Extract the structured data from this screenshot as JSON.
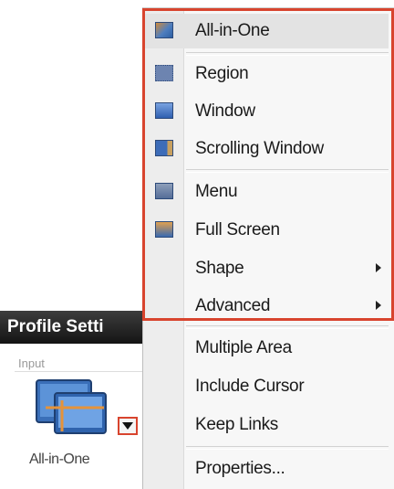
{
  "profile": {
    "header": "Profile Setti",
    "section_label": "Input",
    "input_type_label": "All-in-One"
  },
  "menu": {
    "items": [
      {
        "label": "All-in-One",
        "icon": "all-in-one-icon",
        "has_submenu": false
      },
      {
        "label": "Region",
        "icon": "region-icon",
        "has_submenu": false
      },
      {
        "label": "Window",
        "icon": "window-icon",
        "has_submenu": false
      },
      {
        "label": "Scrolling Window",
        "icon": "scrolling-window-icon",
        "has_submenu": false
      },
      {
        "label": "Menu",
        "icon": "menu-icon",
        "has_submenu": false
      },
      {
        "label": "Full Screen",
        "icon": "full-screen-icon",
        "has_submenu": false
      },
      {
        "label": "Shape",
        "has_submenu": true
      },
      {
        "label": "Advanced",
        "has_submenu": true
      },
      {
        "label": "Multiple Area",
        "has_submenu": false
      },
      {
        "label": "Include Cursor",
        "has_submenu": false
      },
      {
        "label": "Keep Links",
        "has_submenu": false
      },
      {
        "label": "Properties...",
        "has_submenu": false
      }
    ]
  },
  "colors": {
    "highlight_border": "#d8442e",
    "header_bg": "#1e1e1e"
  }
}
